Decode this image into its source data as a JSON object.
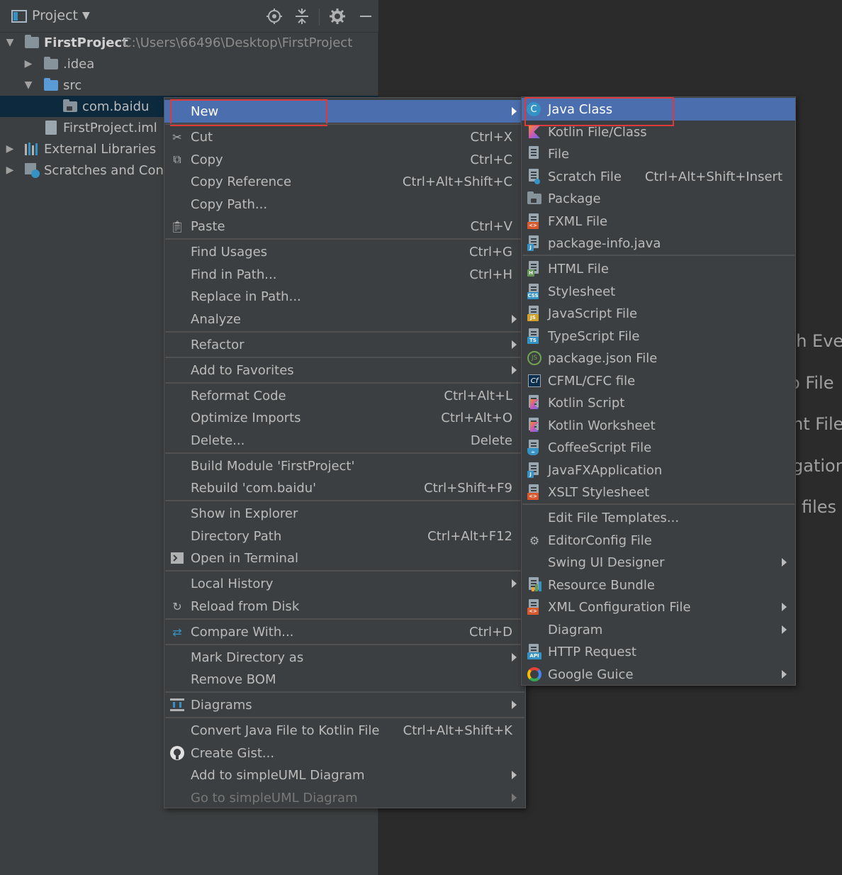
{
  "project_panel": {
    "title": "Project",
    "tree": [
      {
        "label": "FirstProject",
        "path": "C:\\Users\\66496\\Desktop\\FirstProject"
      },
      {
        "label": ".idea"
      },
      {
        "label": "src"
      },
      {
        "label": "com.baidu"
      },
      {
        "label": "FirstProject.iml"
      },
      {
        "label": "External Libraries"
      },
      {
        "label": "Scratches and Consoles"
      }
    ]
  },
  "context_menu": {
    "new": "New",
    "cut": {
      "label": "Cut",
      "shortcut": "Ctrl+X"
    },
    "copy": {
      "label": "Copy",
      "shortcut": "Ctrl+C"
    },
    "copy_reference": {
      "label": "Copy Reference",
      "shortcut": "Ctrl+Alt+Shift+C"
    },
    "copy_path": {
      "label": "Copy Path..."
    },
    "paste": {
      "label": "Paste",
      "shortcut": "Ctrl+V"
    },
    "find_usages": {
      "label": "Find Usages",
      "shortcut": "Ctrl+G"
    },
    "find_in_path": {
      "label": "Find in Path...",
      "shortcut": "Ctrl+H"
    },
    "replace_in_path": {
      "label": "Replace in Path..."
    },
    "analyze": {
      "label": "Analyze"
    },
    "refactor": {
      "label": "Refactor"
    },
    "add_to_favorites": {
      "label": "Add to Favorites"
    },
    "reformat_code": {
      "label": "Reformat Code",
      "shortcut": "Ctrl+Alt+L"
    },
    "optimize_imports": {
      "label": "Optimize Imports",
      "shortcut": "Ctrl+Alt+O"
    },
    "delete": {
      "label": "Delete...",
      "shortcut": "Delete"
    },
    "build_module": {
      "label": "Build Module 'FirstProject'"
    },
    "rebuild": {
      "label": "Rebuild 'com.baidu'",
      "shortcut": "Ctrl+Shift+F9"
    },
    "show_in_explorer": {
      "label": "Show in Explorer"
    },
    "directory_path": {
      "label": "Directory Path",
      "shortcut": "Ctrl+Alt+F12"
    },
    "open_in_terminal": {
      "label": "Open in Terminal"
    },
    "local_history": {
      "label": "Local History"
    },
    "reload_from_disk": {
      "label": "Reload from Disk"
    },
    "compare_with": {
      "label": "Compare With...",
      "shortcut": "Ctrl+D"
    },
    "mark_directory_as": {
      "label": "Mark Directory as"
    },
    "remove_bom": {
      "label": "Remove BOM"
    },
    "diagrams": {
      "label": "Diagrams"
    },
    "convert_to_kotlin": {
      "label": "Convert Java File to Kotlin File",
      "shortcut": "Ctrl+Alt+Shift+K"
    },
    "create_gist": {
      "label": "Create Gist..."
    },
    "add_to_simpleuml": {
      "label": "Add to simpleUML Diagram"
    },
    "go_to_simpleuml": {
      "label": "Go to simpleUML Diagram"
    }
  },
  "submenu": {
    "java_class": "Java Class",
    "kotlin_file_class": "Kotlin File/Class",
    "file": "File",
    "scratch_file": {
      "label": "Scratch File",
      "shortcut": "Ctrl+Alt+Shift+Insert"
    },
    "package": "Package",
    "fxml_file": "FXML File",
    "package_info": "package-info.java",
    "html_file": "HTML File",
    "stylesheet": "Stylesheet",
    "javascript_file": "JavaScript File",
    "typescript_file": "TypeScript File",
    "package_json": "package.json File",
    "cfml_file": "CFML/CFC file",
    "kotlin_script": "Kotlin Script",
    "kotlin_worksheet": "Kotlin Worksheet",
    "coffeescript_file": "CoffeeScript File",
    "javafx_application": "JavaFXApplication",
    "xslt_stylesheet": "XSLT Stylesheet",
    "edit_file_templates": "Edit File Templates...",
    "editorconfig_file": "EditorConfig File",
    "swing_ui_designer": "Swing UI Designer",
    "resource_bundle": "Resource Bundle",
    "xml_configuration_file": "XML Configuration File",
    "diagram": "Diagram",
    "http_request": "HTTP Request",
    "google_guice": "Google Guice"
  },
  "icon_tags": {
    "html": "H",
    "css": "CSS",
    "js": "JS",
    "ts": "TS",
    "cf": "Cf",
    "api": "API",
    "nodejs": "JS",
    "java_c": "C"
  },
  "editor_hints": [
    "ch Eve",
    "o File",
    "nt File",
    "gation",
    "files i"
  ],
  "colors": {
    "selection": "#4b6eaf",
    "highlight_box": "#e0393a",
    "tree_selected": "#0d293e"
  }
}
